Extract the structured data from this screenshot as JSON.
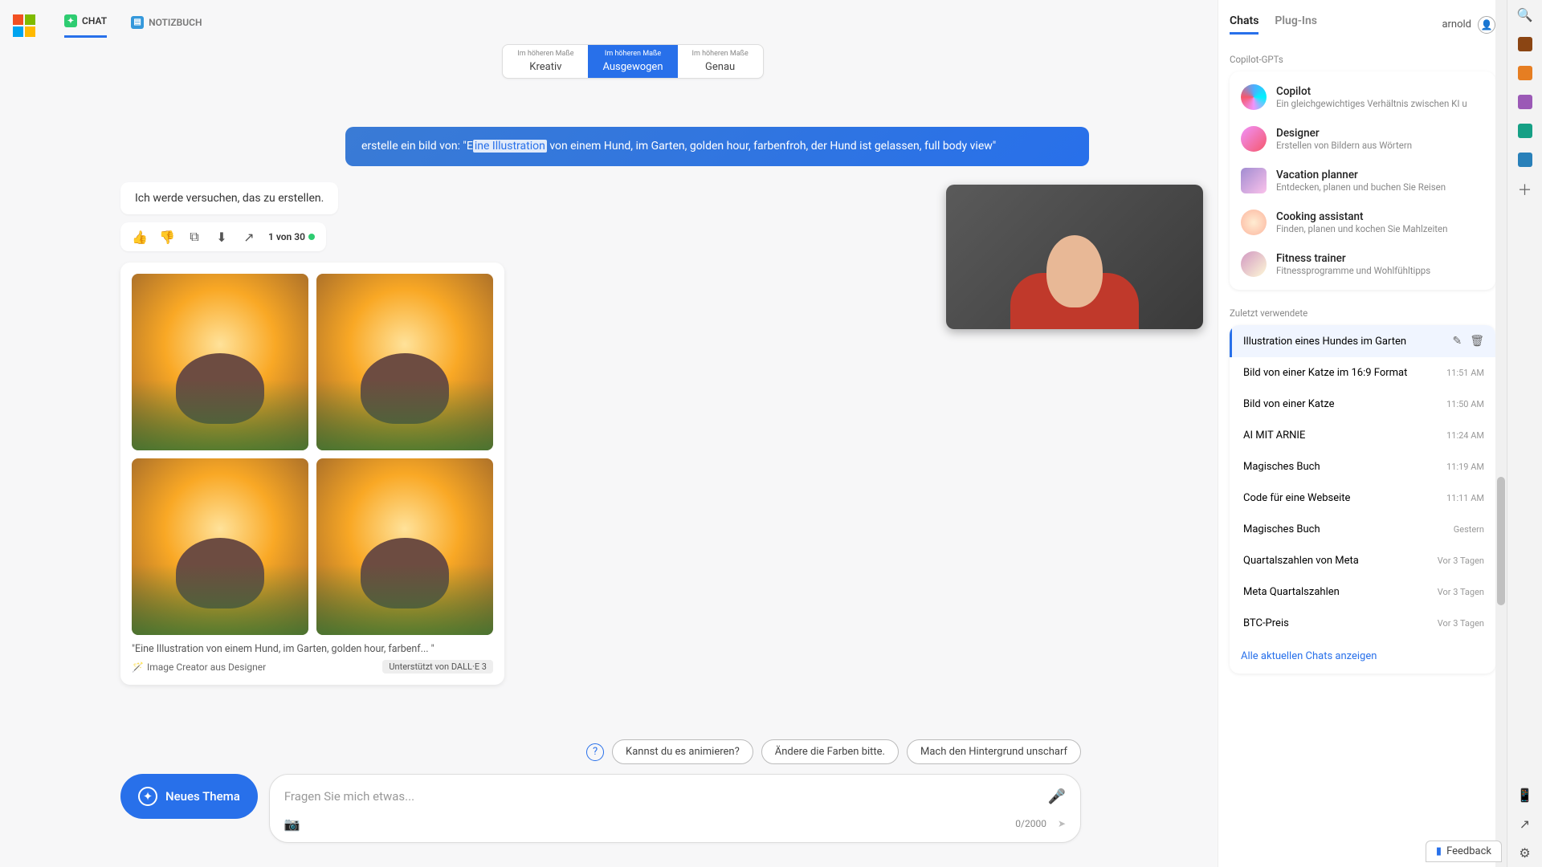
{
  "top_tabs": {
    "chat": "CHAT",
    "notebook": "NOTIZBUCH"
  },
  "styles": {
    "sup": "Im höheren Maße",
    "creative": "Kreativ",
    "balanced": "Ausgewogen",
    "precise": "Genau"
  },
  "copy_label": "Kopieren",
  "user_msg": {
    "pre": "erstelle ein bild von: \"E",
    "hl": "ine Illustration",
    "post": " von einem Hund, im Garten, golden hour, farbenfroh, der Hund ist gelassen, full body view\""
  },
  "assistant_line": "Ich werde versuchen, das zu erstellen.",
  "counter": "1 von 30",
  "caption": "\"Eine Illustration von einem Hund, im Garten, golden hour, farbenf... \"",
  "creator_src": "Image Creator aus Designer",
  "dalle_badge": "Unterstützt von DALL·E 3",
  "suggestions": [
    "Kannst du es animieren?",
    "Ändere die Farben bitte.",
    "Mach den Hintergrund unscharf"
  ],
  "new_topic": "Neues Thema",
  "input_placeholder": "Fragen Sie mich etwas...",
  "char_count": "0/2000",
  "right": {
    "tabs": {
      "chats": "Chats",
      "plugins": "Plug-Ins"
    },
    "user": "arnold",
    "gpt_label": "Copilot-GPTs",
    "gpts": [
      {
        "title": "Copilot",
        "sub": "Ein gleichgewichtiges Verhältnis zwischen KI u"
      },
      {
        "title": "Designer",
        "sub": "Erstellen von Bildern aus Wörtern"
      },
      {
        "title": "Vacation planner",
        "sub": "Entdecken, planen und buchen Sie Reisen"
      },
      {
        "title": "Cooking assistant",
        "sub": "Finden, planen und kochen Sie Mahlzeiten"
      },
      {
        "title": "Fitness trainer",
        "sub": "Fitnessprogramme und Wohlfühltipps"
      }
    ],
    "recent_label": "Zuletzt verwendete",
    "recents": [
      {
        "t": "Illustration eines Hundes im Garten",
        "m": "",
        "active": true
      },
      {
        "t": "Bild von einer Katze im 16:9 Format",
        "m": "11:51 AM"
      },
      {
        "t": "Bild von einer Katze",
        "m": "11:50 AM"
      },
      {
        "t": "AI MIT ARNIE",
        "m": "11:24 AM"
      },
      {
        "t": "Magisches Buch",
        "m": "11:19 AM"
      },
      {
        "t": "Code für eine Webseite",
        "m": "11:11 AM"
      },
      {
        "t": "Magisches Buch",
        "m": "Gestern"
      },
      {
        "t": "Quartalszahlen von Meta",
        "m": "Vor 3 Tagen"
      },
      {
        "t": "Meta Quartalszahlen",
        "m": "Vor 3 Tagen"
      },
      {
        "t": "BTC-Preis",
        "m": "Vor 3 Tagen"
      }
    ],
    "show_all": "Alle aktuellen Chats anzeigen"
  },
  "feedback": "Feedback"
}
